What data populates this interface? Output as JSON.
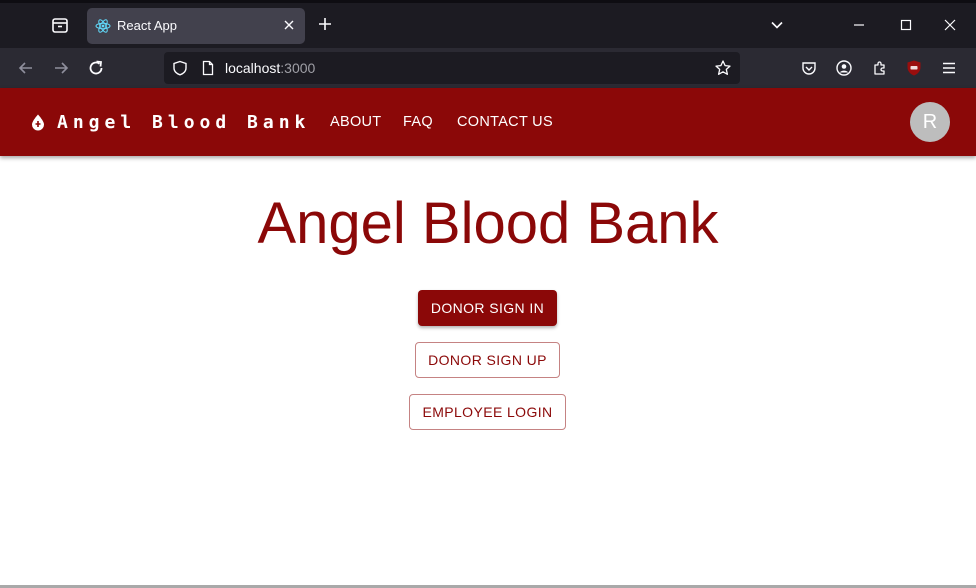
{
  "browser": {
    "tab_title": "React App",
    "url_host": "localhost",
    "url_port": ":3000",
    "icons": [
      "tab-overview-icon",
      "react-favicon-icon",
      "close-icon",
      "plus-icon",
      "chevron-down-icon",
      "minimize-icon",
      "maximize-icon",
      "close-window-icon",
      "back-arrow-icon",
      "forward-arrow-icon",
      "reload-icon",
      "shield-icon",
      "page-icon",
      "star-icon",
      "pocket-icon",
      "account-icon",
      "extensions-icon",
      "ublock-icon",
      "hamburger-menu-icon"
    ]
  },
  "appbar": {
    "brand": "Angel Blood Bank",
    "brand_icon": "blood-drop-icon",
    "nav": [
      "ABOUT",
      "FAQ",
      "CONTACT US"
    ],
    "avatar_letter": "R",
    "color": "#8b0808"
  },
  "main": {
    "title": "Angel Blood Bank",
    "buttons": {
      "donor_sign_in": "DONOR SIGN IN",
      "donor_sign_up": "DONOR SIGN UP",
      "employee_login": "EMPLOYEE LOGIN"
    },
    "accent_color": "#8b0808"
  }
}
